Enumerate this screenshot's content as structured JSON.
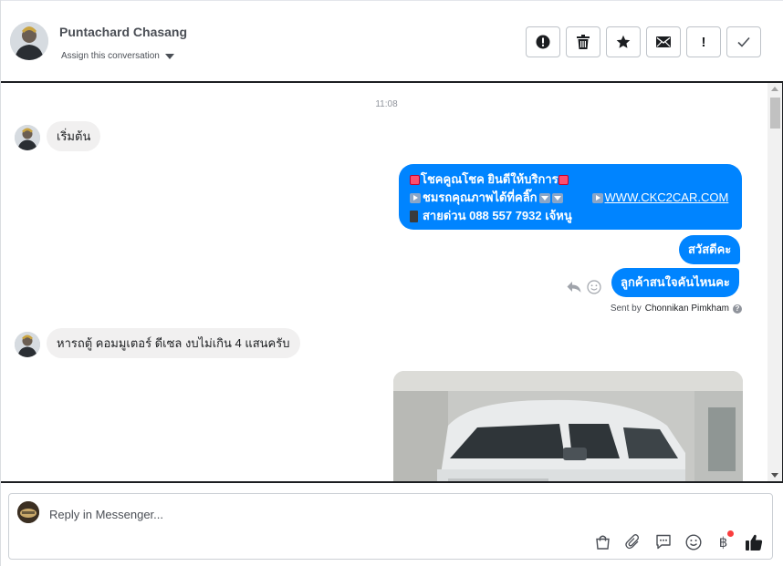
{
  "header": {
    "contact_name": "Puntachard Chasang",
    "assign_label": "Assign this conversation",
    "actions": [
      {
        "icon": "alert-circle-icon"
      },
      {
        "icon": "trash-icon"
      },
      {
        "icon": "star-icon"
      },
      {
        "icon": "envelope-icon"
      },
      {
        "icon": "exclamation-icon",
        "label": "!"
      },
      {
        "icon": "checkmark-icon"
      }
    ]
  },
  "conversation": {
    "timestamp": "11:08",
    "messages": [
      {
        "from": "customer",
        "text": "เริ่มต้น"
      },
      {
        "from": "page",
        "lines": [
          "โชคคูณโชค ยินดีให้บริการ",
          "ชมรถคุณภาพได้ที่คลิ๊ก",
          "WWW.CKC2CAR.COM",
          "สายด่วน 088 557 7932 เจ้หนู"
        ]
      },
      {
        "from": "page",
        "text": "สวัสดีคะ"
      },
      {
        "from": "page",
        "text": "ลูกค้าสนใจคันไหนคะ"
      },
      {
        "from": "customer",
        "text": "หารถตู้ คอมมูเตอร์ ดีเซล งบไม่เกิน 4 แสนครับ"
      }
    ],
    "sent_by_prefix": "Sent by",
    "sent_by_name": "Chonnikan Pimkham"
  },
  "composer": {
    "placeholder": "Reply in Messenger...",
    "tools": [
      "shopping-bag-icon",
      "paperclip-icon",
      "saved-reply-icon",
      "emoji-icon",
      "baht-payment-icon",
      "thumbs-up-icon"
    ],
    "baht_symbol": "฿"
  },
  "colors": {
    "accent": "#0084ff",
    "incoming_bubble": "#f1f0f0",
    "notification_dot": "#fa3e3e"
  }
}
